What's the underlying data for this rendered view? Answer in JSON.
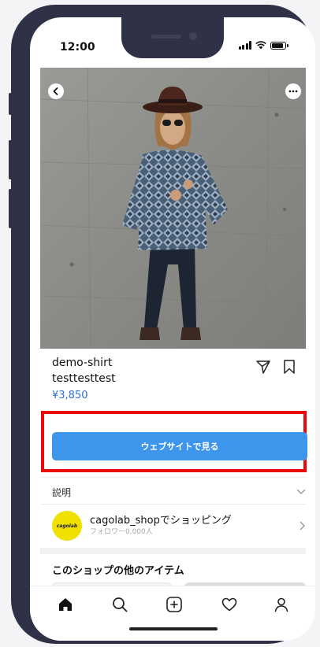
{
  "status_bar": {
    "time": "12:00"
  },
  "product": {
    "name": "demo-shirt",
    "subtitle": "testtesttest",
    "price": "¥3,850"
  },
  "cta": {
    "label": "ウェブサイトで見る"
  },
  "description": {
    "label": "説明"
  },
  "shop": {
    "logo_text": "cagolab",
    "name": "cagolab_shopでショッピング",
    "followers": "フォロワー0,000人"
  },
  "more_items": {
    "title": "このショップの他のアイテム"
  },
  "colors": {
    "accent": "#3d95ec",
    "highlight": "#ea0a0a",
    "price": "#2d6fd6",
    "frame": "#2f3147",
    "logo": "#f0e000"
  },
  "icons": {
    "back": "chevron-left-icon",
    "more": "ellipsis-icon",
    "share": "paper-plane-icon",
    "save": "bookmark-icon",
    "expand": "chevron-down-icon",
    "shop_arrow": "chevron-right-icon",
    "tabs": [
      "home-icon",
      "search-icon",
      "add-icon",
      "heart-icon",
      "profile-icon"
    ]
  }
}
